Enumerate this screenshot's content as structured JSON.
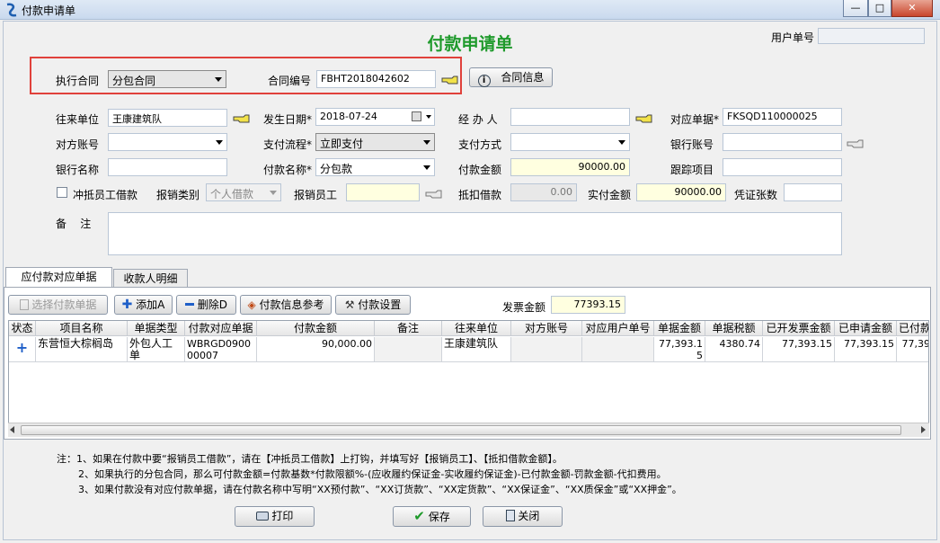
{
  "window": {
    "title": "付款申请单",
    "minimize": "—",
    "maximize": "□",
    "close": "✕"
  },
  "header": {
    "title": "付款申请单",
    "user_no_label": "用户单号",
    "user_no_value": ""
  },
  "contract": {
    "exec_label": "执行合同",
    "exec_value": "分包合同",
    "no_label": "合同编号",
    "no_value": "FBHT2018042602",
    "info_button": "合同信息"
  },
  "form": {
    "partner_label": "往来单位",
    "partner_value": "王康建筑队",
    "date_label": "发生日期*",
    "date_value": "2018-07-24",
    "handler_label": "经 办 人",
    "handler_value": "",
    "ref_label": "对应单据*",
    "ref_value": "FKSQD110000025",
    "counter_acct_label": "对方账号",
    "counter_acct_value": "",
    "pay_flow_label": "支付流程*",
    "pay_flow_value": "立即支付",
    "pay_method_label": "支付方式",
    "pay_method_value": "",
    "bank_acct_label": "银行账号",
    "bank_acct_value": "",
    "bank_name_label": "银行名称",
    "bank_name_value": "",
    "pay_name_label": "付款名称*",
    "pay_name_value": "分包款",
    "pay_amount_label": "付款金额",
    "pay_amount_value": "90000.00",
    "track_label": "跟踪项目",
    "track_value": "",
    "offset_label": "冲抵员工借款",
    "claim_type_label": "报销类别",
    "claim_type_value": "个人借款",
    "claim_emp_label": "报销员工",
    "claim_emp_value": "",
    "deduct_label": "抵扣借款",
    "deduct_value": "0.00",
    "actual_label": "实付金额",
    "actual_value": "90000.00",
    "voucher_label": "凭证张数",
    "voucher_value": "",
    "remark_label": "备    注",
    "remark_value": ""
  },
  "tabs": [
    {
      "label": "应付款对应单据"
    },
    {
      "label": "收款人明细"
    }
  ],
  "toolbar": {
    "select_docs": "选择付款单据",
    "add": "添加A",
    "delete": "删除D",
    "pay_ref": "付款信息参考",
    "pay_settings": "付款设置",
    "invoice_label": "发票金额",
    "invoice_value": "77393.15"
  },
  "grid": {
    "columns": [
      "状态",
      "项目名称",
      "单据类型",
      "付款对应单据",
      "付款金额",
      "备注",
      "往来单位",
      "对方账号",
      "对应用户单号",
      "单据金额",
      "单据税额",
      "已开发票金额",
      "已申请金额",
      "已付款"
    ],
    "rows": [
      {
        "status": "+",
        "project": "东营恒大棕榈岛",
        "doc_type": "外包人工单",
        "doc_no": "WBRGD090000007",
        "amount": "90,000.00",
        "remark": "",
        "partner": "王康建筑队",
        "counter_acct": "",
        "user_no": "",
        "doc_amount": "77,393.15",
        "tax": "4380.74",
        "invoiced": "77,393.15",
        "applied": "77,393.15",
        "paid": "77,39"
      }
    ]
  },
  "notes": [
    "注：1、如果在付款中要“报销员工借款”，请在【冲抵员工借款】上打钩，并填写好【报销员工】、【抵扣借款金额】。",
    "2、如果执行的分包合同，那么可付款金额=付款基数*付款限额%-(应收履约保证金-实收履约保证金)-已付款金额-罚款金额-代扣费用。",
    "3、如果付款没有对应付款单据，请在付款名称中写明“XX预付款”、“XX订货款”、“XX定货款”、“XX保证金”、“XX质保金”或“XX押金”。"
  ],
  "footer": {
    "print": "打印",
    "save": "保存",
    "close": "关闭"
  }
}
